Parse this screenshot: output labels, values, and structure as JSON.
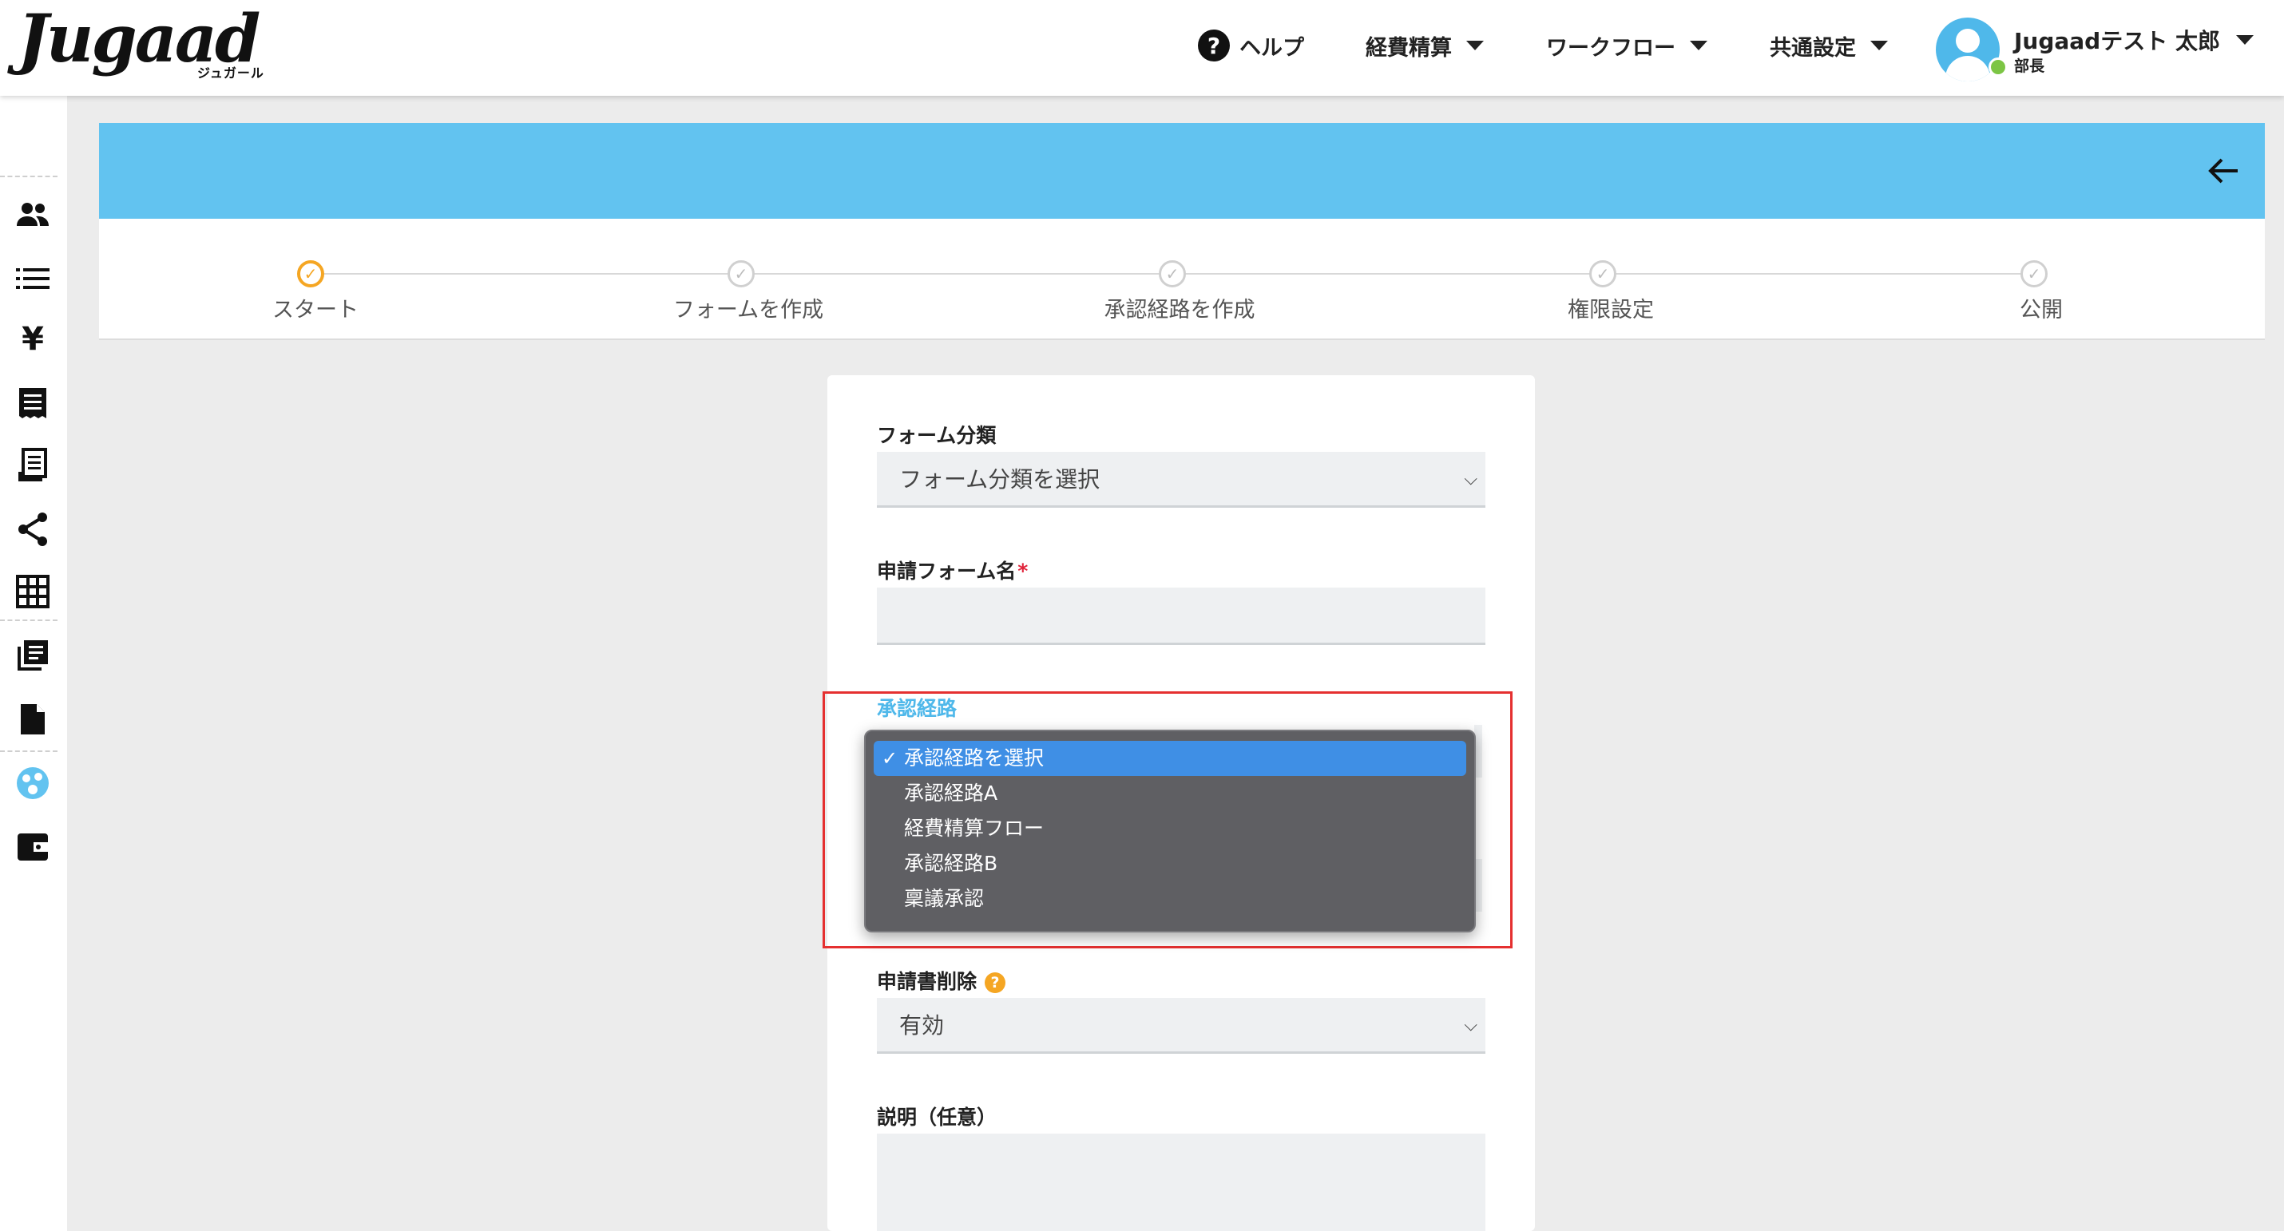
{
  "header": {
    "logo_text": "Jugaad",
    "logo_sub": "ジュガール",
    "help_label": "ヘルプ",
    "menu_expense": "経費精算",
    "menu_workflow": "ワークフロー",
    "menu_settings": "共通設定",
    "user_name": "Jugaadテスト 太郎",
    "user_role": "部長"
  },
  "sidebar": {
    "icons": [
      "users-icon",
      "list-icon",
      "yen-icon",
      "receipt-icon",
      "document-list-icon",
      "share-icon",
      "grid-icon",
      "library-icon",
      "file-icon",
      "workflow-icon",
      "wallet-icon"
    ]
  },
  "stepper": {
    "steps": [
      {
        "label": "スタート",
        "state": "active"
      },
      {
        "label": "フォームを作成",
        "state": "pending"
      },
      {
        "label": "承認経路を作成",
        "state": "pending"
      },
      {
        "label": "権限設定",
        "state": "pending"
      },
      {
        "label": "公開",
        "state": "pending"
      }
    ]
  },
  "form": {
    "category_label": "フォーム分類",
    "category_value": "フォーム分類を選択",
    "name_label": "申請フォーム名",
    "name_required_mark": "*",
    "route_label": "承認経路",
    "delete_label": "申請書削除",
    "delete_value": "有効",
    "description_label": "説明（任意）"
  },
  "dropdown": {
    "options": [
      "承認経路を選択",
      "承認経路A",
      "経費精算フロー",
      "承認経路B",
      "稟議承認"
    ],
    "selected": "承認経路を選択"
  },
  "colors": {
    "accent": "#62c3f0",
    "active_step": "#f5a623",
    "highlight": "#e53030",
    "selected_option": "#3f8fe5"
  }
}
